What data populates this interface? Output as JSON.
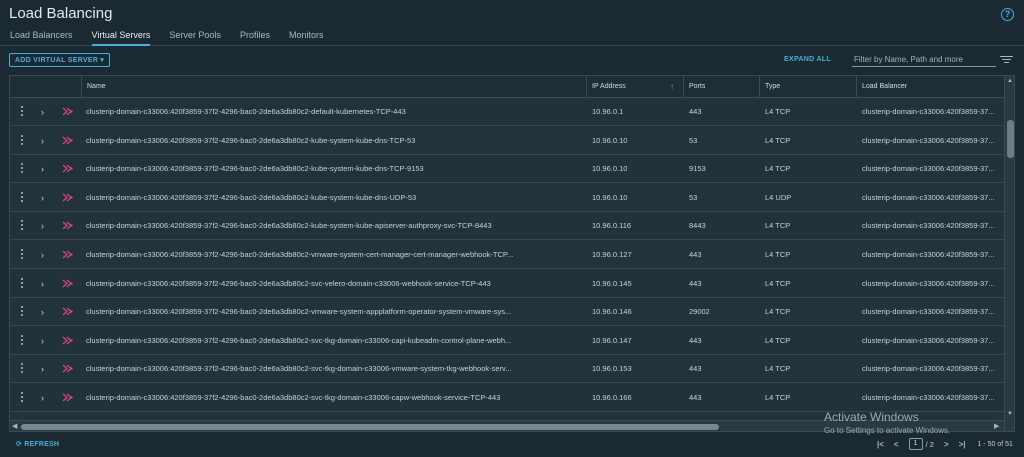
{
  "header": {
    "title": "Load Balancing",
    "tabs": [
      {
        "label": "Load Balancers"
      },
      {
        "label": "Virtual Servers",
        "active": true
      },
      {
        "label": "Server Pools"
      },
      {
        "label": "Profiles"
      },
      {
        "label": "Monitors"
      }
    ]
  },
  "toolbar": {
    "add_label": "ADD VIRTUAL SERVER",
    "add_caret": "▾",
    "expand_all": "EXPAND ALL",
    "filter_placeholder": "Filter by Name, Path and more"
  },
  "table": {
    "columns": [
      "Name",
      "IP Address",
      "Ports",
      "Type",
      "Load Balancer"
    ],
    "sort_arrow": "↑",
    "rows": [
      {
        "name": "clusterip-domain-c33006:420f3859-37f2-4296-bac0-2de6a3db80c2-default-kubernetes-TCP-443",
        "ip": "10.96.0.1",
        "ports": "443",
        "type": "L4 TCP",
        "lb": "clusterip-domain-c33006:420f3859-37..."
      },
      {
        "name": "clusterip-domain-c33006:420f3859-37f2-4296-bac0-2de6a3db80c2-kube-system-kube-dns-TCP-53",
        "ip": "10.96.0.10",
        "ports": "53",
        "type": "L4 TCP",
        "lb": "clusterip-domain-c33006:420f3859-37..."
      },
      {
        "name": "clusterip-domain-c33006:420f3859-37f2-4296-bac0-2de6a3db80c2-kube-system-kube-dns-TCP-9153",
        "ip": "10.96.0.10",
        "ports": "9153",
        "type": "L4 TCP",
        "lb": "clusterip-domain-c33006:420f3859-37..."
      },
      {
        "name": "clusterip-domain-c33006:420f3859-37f2-4296-bac0-2de6a3db80c2-kube-system-kube-dns-UDP-53",
        "ip": "10.96.0.10",
        "ports": "53",
        "type": "L4 UDP",
        "lb": "clusterip-domain-c33006:420f3859-37..."
      },
      {
        "name": "clusterip-domain-c33006:420f3859-37f2-4296-bac0-2de6a3db80c2-kube-system-kube-apiserver-authproxy-svc-TCP-8443",
        "ip": "10.96.0.116",
        "ports": "8443",
        "type": "L4 TCP",
        "lb": "clusterip-domain-c33006:420f3859-37..."
      },
      {
        "name": "clusterip-domain-c33006:420f3859-37f2-4296-bac0-2de6a3db80c2-vmware-system-cert-manager-cert-manager-webhook-TCP...",
        "ip": "10.96.0.127",
        "ports": "443",
        "type": "L4 TCP",
        "lb": "clusterip-domain-c33006:420f3859-37..."
      },
      {
        "name": "clusterip-domain-c33006:420f3859-37f2-4296-bac0-2de6a3db80c2-svc-velero-domain-c33006-webhook-service-TCP-443",
        "ip": "10.96.0.145",
        "ports": "443",
        "type": "L4 TCP",
        "lb": "clusterip-domain-c33006:420f3859-37..."
      },
      {
        "name": "clusterip-domain-c33006:420f3859-37f2-4296-bac0-2de6a3db80c2-vmware-system-appplatform-operator-system-vmware-sys...",
        "ip": "10.96.0.146",
        "ports": "29002",
        "type": "L4 TCP",
        "lb": "clusterip-domain-c33006:420f3859-37..."
      },
      {
        "name": "clusterip-domain-c33006:420f3859-37f2-4296-bac0-2de6a3db80c2-svc-tkg-domain-c33006-capi-kubeadm-control-plane-webh...",
        "ip": "10.96.0.147",
        "ports": "443",
        "type": "L4 TCP",
        "lb": "clusterip-domain-c33006:420f3859-37..."
      },
      {
        "name": "clusterip-domain-c33006:420f3859-37f2-4296-bac0-2de6a3db80c2-svc-tkg-domain-c33006-vmware-system-tkg-webhook-serv...",
        "ip": "10.96.0.153",
        "ports": "443",
        "type": "L4 TCP",
        "lb": "clusterip-domain-c33006:420f3859-37..."
      },
      {
        "name": "clusterip-domain-c33006:420f3859-37f2-4296-bac0-2de6a3db80c2-svc-tkg-domain-c33006-capw-webhook-service-TCP-443",
        "ip": "10.96.0.166",
        "ports": "443",
        "type": "L4 TCP",
        "lb": "clusterip-domain-c33006:420f3859-37..."
      }
    ]
  },
  "footer": {
    "refresh_label": "REFRESH",
    "refresh_icon": "⟳",
    "current_page": "1",
    "total_pages": "/ 2",
    "range_text": "1 - 50 of 51"
  },
  "watermark": {
    "title": "Activate Windows",
    "subtitle": "Go to Settings to activate Windows."
  },
  "colors": {
    "accent": "#49afd9",
    "virtual_server_icon": "#d9467a",
    "background": "#1b2a32"
  }
}
